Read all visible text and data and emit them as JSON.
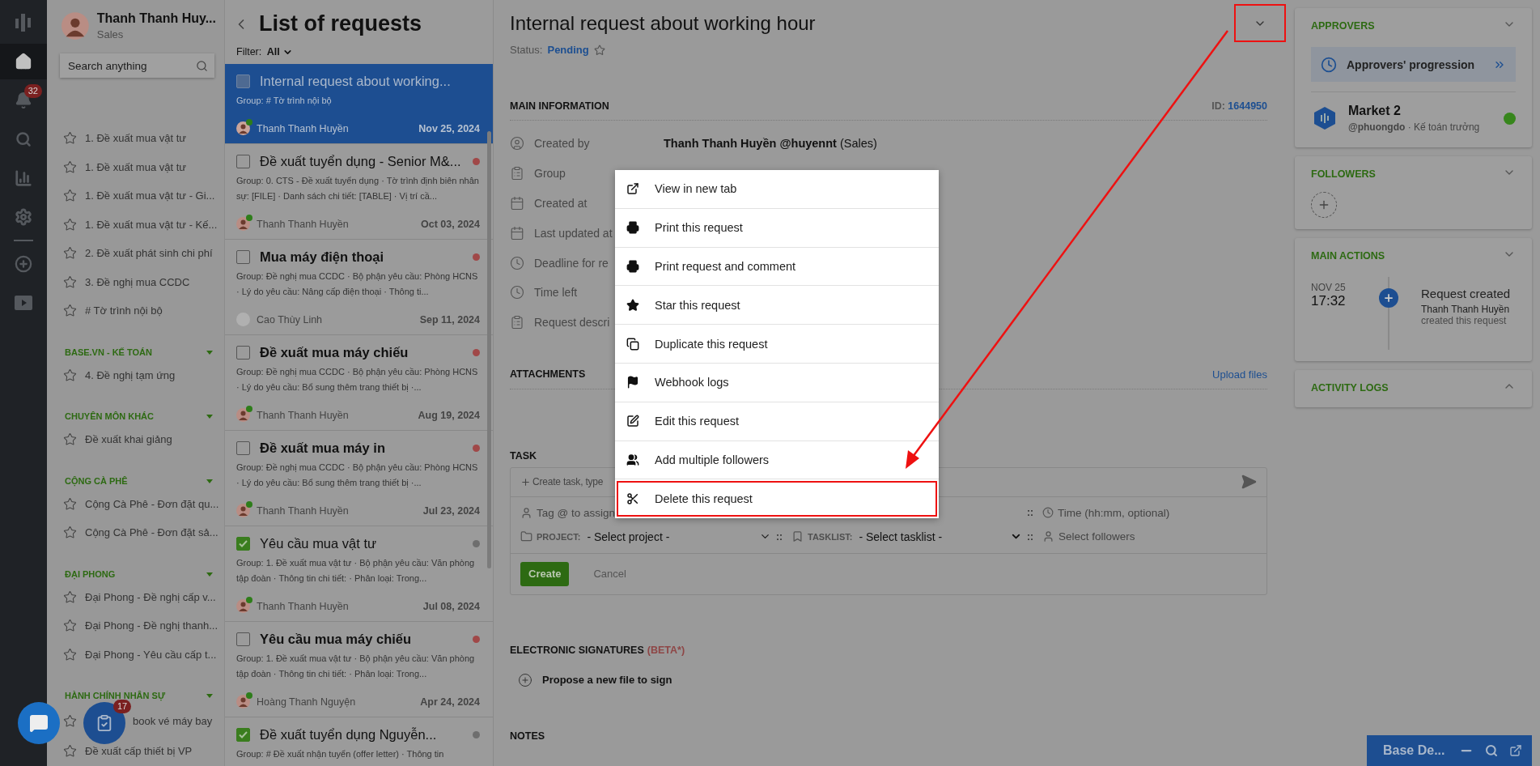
{
  "rail": {
    "items": [
      {
        "kind": "logo",
        "selected": false
      },
      {
        "kind": "home",
        "selected": true
      },
      {
        "kind": "bell",
        "selected": false,
        "badge": "32"
      },
      {
        "kind": "search",
        "selected": false
      },
      {
        "kind": "chart",
        "selected": false
      },
      {
        "kind": "settings",
        "selected": false
      },
      {
        "kind": "divider",
        "selected": false
      },
      {
        "kind": "plus",
        "selected": false
      },
      {
        "kind": "play",
        "selected": false
      }
    ]
  },
  "sidebar": {
    "profile": {
      "name": "Thanh Thanh Huy...",
      "role": "Sales"
    },
    "search": {
      "placeholder": "Search anything"
    },
    "sections": [
      {
        "items": [
          {
            "kind": "link",
            "label": "1. Đề xuất mua vật tư"
          },
          {
            "kind": "link",
            "label": "1. Đề xuất mua vật tư"
          },
          {
            "kind": "link",
            "label": "1. Đề xuất mua vật tư - Gi..."
          },
          {
            "kind": "link",
            "label": "1. Đề xuất mua vật tư - Kế..."
          },
          {
            "kind": "link",
            "label": "2. Đề xuất phát sinh chi phí"
          },
          {
            "kind": "link",
            "label": "3. Đề nghị mua CCDC"
          },
          {
            "kind": "link",
            "label": "# Tờ trình nội bộ"
          }
        ]
      },
      {
        "heading": "BASE.VN - KẾ TOÁN",
        "expanded": true,
        "items": [
          {
            "kind": "link",
            "label": "4. Đề nghị tạm ứng"
          }
        ]
      },
      {
        "heading": "CHUYÊN MÔN KHÁC",
        "expanded": true,
        "items": [
          {
            "kind": "link",
            "label": "Đề xuất khai giảng"
          }
        ]
      },
      {
        "heading": "CỘNG CÀ PHÊ",
        "expanded": true,
        "items": [
          {
            "kind": "link",
            "label": "Cộng Cà Phê - Đơn đặt qu..."
          },
          {
            "kind": "link",
            "label": "Cộng Cà Phê - Đơn đặt sả..."
          }
        ]
      },
      {
        "heading": "ĐẠI PHONG",
        "expanded": true,
        "items": [
          {
            "kind": "link",
            "label": "Đại Phong - Đề nghị cấp v..."
          },
          {
            "kind": "link",
            "label": "Đại Phong - Đề nghị thanh..."
          },
          {
            "kind": "link",
            "label": "Đại Phong - Yêu cầu cấp t..."
          }
        ]
      },
      {
        "heading": "HÀNH CHÍNH NHÂN SỰ",
        "expanded": true,
        "items": [
          {
            "kind": "partial",
            "label": "book vé máy bay"
          },
          {
            "kind": "link",
            "label": "Đề xuất cấp thiết bị VP"
          }
        ]
      }
    ]
  },
  "list": {
    "title": "List of requests",
    "filter_label": "Filter:",
    "filter_value": "All",
    "requests": [
      {
        "title": "Internal request about working...",
        "unread": false,
        "selected": true,
        "checked": false,
        "summary": "Group: # Tờ trình nội bộ",
        "author": "Thanh Thanh Huyền",
        "online": true,
        "date": "Nov 25, 2024"
      },
      {
        "title": "Đề xuất tuyển dụng - Senior M&...",
        "unread": false,
        "selected": false,
        "checked": false,
        "color": "#a04848",
        "summary": "Group: 0. CTS - Đề xuất tuyển dụng · Tờ trình định biên nhân sự: [FILE] · Danh sách chi tiết: [TABLE] · Vị trí cầ...",
        "author": "Thanh Thanh Huyền",
        "online": true,
        "date": "Oct 03, 2024"
      },
      {
        "title": "Mua máy điện thoại",
        "unread": true,
        "selected": false,
        "checked": false,
        "color": "#a04848",
        "summary": "Group: Đề nghị mua CCDC · Bộ phận yêu cầu: Phòng HCNS · Lý do yêu cầu: Nâng cấp điện thoại · Thông ti...",
        "author": "Cao Thùy Linh",
        "online": false,
        "date": "Sep 11, 2024"
      },
      {
        "title": "Đề xuất mua máy chiếu",
        "unread": true,
        "selected": false,
        "checked": false,
        "color": "#a04848",
        "summary": "Group: Đề nghị mua CCDC · Bộ phận yêu cầu: Phòng HCNS · Lý do yêu cầu: Bổ sung thêm trang thiết bị ·...",
        "author": "Thanh Thanh Huyền",
        "online": true,
        "date": "Aug 19, 2024"
      },
      {
        "title": "Đề xuất mua máy in",
        "unread": true,
        "selected": false,
        "checked": false,
        "color": "#a04848",
        "summary": "Group: Đề nghị mua CCDC · Bộ phận yêu cầu: Phòng HCNS · Lý do yêu cầu: Bổ sung thêm trang thiết bị ·...",
        "author": "Thanh Thanh Huyền",
        "online": true,
        "date": "Jul 23, 2024"
      },
      {
        "title": "Yêu cầu mua vật tư",
        "unread": false,
        "selected": false,
        "checked": true,
        "color": "#6e6e6e",
        "summary": "Group: 1. Đề xuất mua vật tư · Bộ phận yêu cầu: Văn phòng tập đoàn · Thông tin chi tiết: · Phân loại: Trong...",
        "author": "Thanh Thanh Huyền",
        "online": true,
        "date": "Jul 08, 2024"
      },
      {
        "title": "Yêu cầu mua máy chiếu",
        "unread": true,
        "selected": false,
        "checked": false,
        "color": "#a04848",
        "summary": "Group: 1. Đề xuất mua vật tư · Bộ phận yêu cầu: Văn phòng tập đoàn · Thông tin chi tiết: · Phân loại: Trong...",
        "author": "Hoàng Thanh Nguyện",
        "online": true,
        "date": "Apr 24, 2024"
      },
      {
        "title": "Đề xuất tuyển dụng Nguyễn...",
        "unread": false,
        "selected": false,
        "checked": true,
        "color": "#6e6e6e",
        "summary": "Group: # Đề xuất nhận tuyển (offer letter) · Thông tin"
      }
    ]
  },
  "detail": {
    "title": "Internal request about working hour",
    "menu_button_highlighted": true,
    "status_label": "Status:",
    "status": "Pending",
    "main_info": {
      "heading": "MAIN INFORMATION",
      "id_label": "ID:",
      "id": "1644950",
      "rows": [
        {
          "kind": "user",
          "label": "Created by",
          "value": "**Thanh Thanh Huyền @huyennt** (Sales)"
        },
        {
          "kind": "clipboard",
          "label": "Group"
        },
        {
          "kind": "calendar",
          "label": "Created at"
        },
        {
          "kind": "calendar",
          "label": "Last updated at"
        },
        {
          "kind": "clock",
          "label": "Deadline for re"
        },
        {
          "kind": "clock",
          "label": "Time left"
        },
        {
          "kind": "clipboard",
          "label": "Request descri"
        }
      ]
    },
    "attachments": {
      "heading": "ATTACHMENTS",
      "action": "Upload files"
    },
    "task": {
      "heading": "TASK",
      "placeholder": "Create task, type",
      "assign": "Tag @ to assign",
      "time_separator": "::",
      "time": "Time (hh:mm, optional)",
      "tasklist_separator": "::",
      "followers_separator": "::",
      "project_label": "PROJECT:",
      "project_value": "- Select project -",
      "tasklist_label": "TASKLIST:",
      "tasklist_value": "- Select tasklist -",
      "followers": "Select followers",
      "create": "Create",
      "cancel": "Cancel"
    },
    "signatures": {
      "heading": "ELECTRONIC SIGNATURES",
      "tag": "(BETA*)",
      "action": "Propose a new file to sign"
    },
    "notes": {
      "heading": "NOTES"
    }
  },
  "menu": {
    "items": [
      {
        "kind": "external",
        "label": "View in new tab",
        "highlighted": false
      },
      {
        "kind": "print",
        "label": "Print this request",
        "highlighted": false
      },
      {
        "kind": "print",
        "label": "Print request and comment",
        "highlighted": false
      },
      {
        "kind": "star",
        "label": "Star this request",
        "highlighted": false
      },
      {
        "kind": "copy",
        "label": "Duplicate this request",
        "highlighted": false
      },
      {
        "kind": "flag",
        "label": "Webhook logs",
        "highlighted": false
      },
      {
        "kind": "edit",
        "label": "Edit this request",
        "highlighted": false
      },
      {
        "kind": "users",
        "label": "Add multiple followers",
        "highlighted": false
      },
      {
        "kind": "scissors",
        "label": "Delete this request",
        "highlighted": true
      }
    ]
  },
  "annotation_arrow": true,
  "right": {
    "approvers": {
      "heading": "APPROVERS",
      "expanded": true,
      "progress_label": "Approvers' progression",
      "people": [
        {
          "name": "Market 2",
          "handle_line": "**@phuongdo** · Kế toán trưởng",
          "color": "#37861c"
        }
      ]
    },
    "followers": {
      "heading": "FOLLOWERS",
      "expanded": true
    },
    "main_actions": {
      "heading": "MAIN ACTIONS",
      "expanded": true,
      "events": [
        {
          "date": "NOV 25",
          "time": "17:32",
          "title": "Request created",
          "actor": "Thanh Thanh Huyền",
          "note": "created this request"
        }
      ]
    },
    "activity_logs": {
      "heading": "ACTIVITY LOGS",
      "expanded": false
    }
  },
  "task_button": {
    "badge": "17"
  },
  "widget": {
    "title": "Base De..."
  }
}
